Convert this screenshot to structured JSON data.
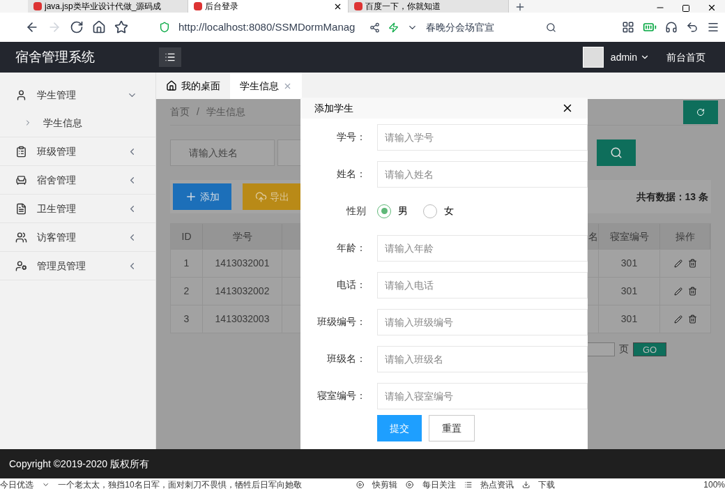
{
  "browser": {
    "tabs": [
      {
        "title": "java.jsp类毕业设计代做_源码成",
        "selected": false
      },
      {
        "title": "后台登录",
        "selected": true
      },
      {
        "title": "百度一下，你就知道",
        "selected": false
      }
    ],
    "address": "http://localhost:8080/SSMDormManag",
    "search_hint": "春晚分会场官宣",
    "status_items": [
      "今日优选",
      "一个老太太，独挡10名日军，面对刺刀不畏惧，牺牲后日军向她敬",
      "快剪辑",
      "每日关注",
      "热点资讯",
      "下载",
      "100%"
    ]
  },
  "app": {
    "title": "宿舍管理系统",
    "user": "admin",
    "home_link": "前台首页"
  },
  "sidebar": {
    "items": [
      {
        "label": "学生管理",
        "kind": "user",
        "expanded": true,
        "children": [
          {
            "label": "学生信息"
          }
        ]
      },
      {
        "label": "班级管理",
        "kind": "clipboard",
        "expanded": false
      },
      {
        "label": "宿舍管理",
        "kind": "armchair",
        "expanded": false
      },
      {
        "label": "卫生管理",
        "kind": "file",
        "expanded": false
      },
      {
        "label": "访客管理",
        "kind": "users",
        "expanded": false
      },
      {
        "label": "管理员管理",
        "kind": "admin",
        "expanded": false
      }
    ]
  },
  "page_tabs": [
    {
      "label": "我的桌面",
      "selected": false
    },
    {
      "label": "学生信息",
      "selected": true
    }
  ],
  "breadcrumb": [
    "首页",
    "学生信息"
  ],
  "breadcrumb_separator": "/",
  "search": {
    "placeholder": "请输入姓名"
  },
  "toolbar": {
    "add": "添加",
    "export": "导出",
    "total": "共有数据：13 条"
  },
  "table": {
    "columns": [
      "ID",
      "学号",
      "名",
      "寝室编号",
      "操作"
    ],
    "rows": [
      {
        "id": "1",
        "student_no": "1413032001",
        "room": "301"
      },
      {
        "id": "2",
        "student_no": "1413032002",
        "room": "301"
      },
      {
        "id": "3",
        "student_no": "1413032003",
        "room": "301"
      }
    ]
  },
  "pagination": {
    "page_label": "页",
    "go": "GO"
  },
  "modal": {
    "title": "添加学生",
    "fields": [
      {
        "kind": "text",
        "label": "学号：",
        "placeholder": "请输入学号"
      },
      {
        "kind": "text",
        "label": "姓名：",
        "placeholder": "请输入姓名"
      },
      {
        "kind": "radio",
        "label": "性别",
        "options": [
          {
            "label": "男",
            "selected": true
          },
          {
            "label": "女",
            "selected": false
          }
        ]
      },
      {
        "kind": "text",
        "label": "年龄：",
        "placeholder": "请输入年龄"
      },
      {
        "kind": "text",
        "label": "电话：",
        "placeholder": "请输入电话"
      },
      {
        "kind": "text",
        "label": "班级编号：",
        "placeholder": "请输入班级编号"
      },
      {
        "kind": "text",
        "label": "班级名：",
        "placeholder": "请输入班级名"
      },
      {
        "kind": "text",
        "label": "寝室编号：",
        "placeholder": "请输入寝室编号"
      }
    ],
    "buttons": [
      {
        "label": "提交",
        "kind": "primary"
      },
      {
        "label": "重置",
        "kind": "default"
      }
    ]
  },
  "footer": "Copyright ©2019-2020 版权所有"
}
